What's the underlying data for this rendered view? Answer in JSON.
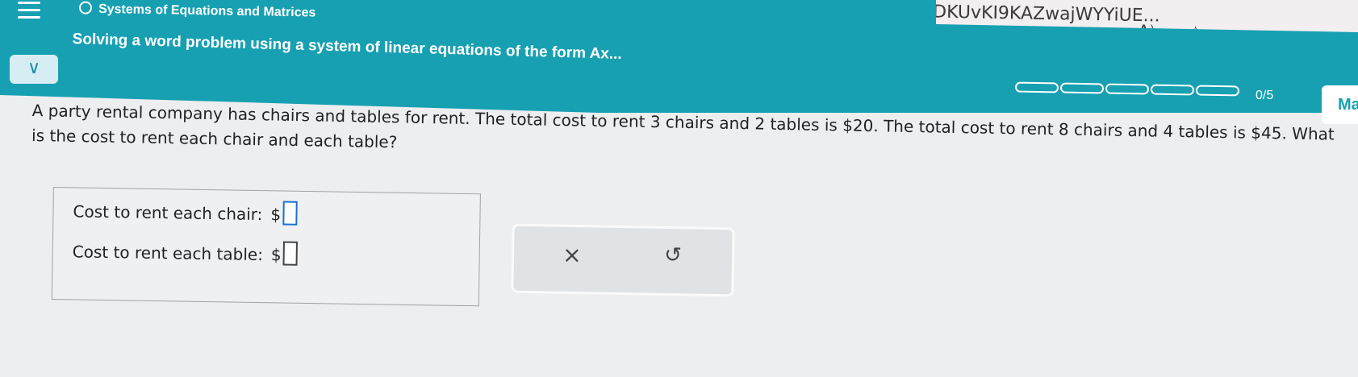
{
  "browser": {
    "url": "QUclQgkSJIONkR4HHkf0EVFNj8DKUvKI9KAZwajWYYiUE...",
    "read_aloud": "A⁾",
    "favorite_icon": "☆",
    "split_icon": "◫",
    "favorites_list_icon": "✩≡",
    "collections_icon": "⊂"
  },
  "header": {
    "topic": "Systems of Equations and Matrices",
    "title": "Solving a word problem using a system of linear equations of the form Ax...",
    "chevron": "∨",
    "progress_total_segments": 5,
    "progress_filled_segments": 0,
    "progress_label": "0/5",
    "side_button": "Ma"
  },
  "question": {
    "text": "A party rental company has chairs and tables for rent. The total cost to rent 3 chairs and 2 tables is $20. The total cost to rent 8 chairs and 4 tables is $45. What is the cost to rent each chair and each table?"
  },
  "answers": {
    "chair_label": "Cost to rent each chair:",
    "table_label": "Cost to rent each table:",
    "currency": "$",
    "chair_value": "",
    "table_value": ""
  },
  "actions": {
    "clear_icon": "×",
    "undo_icon": "↺"
  }
}
